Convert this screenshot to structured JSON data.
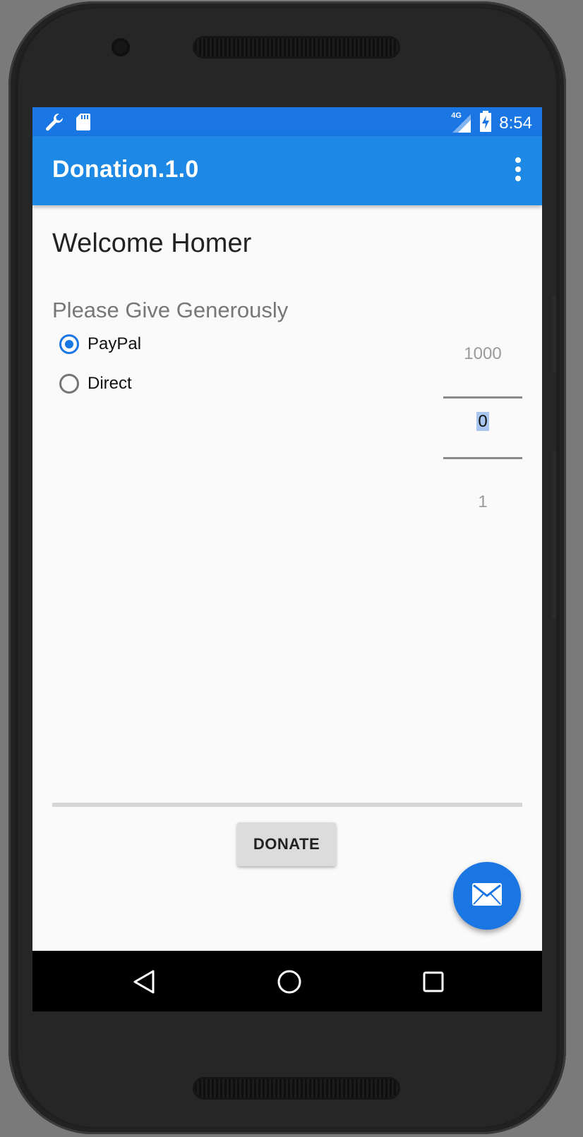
{
  "status_bar": {
    "time": "8:54",
    "network": "4G",
    "icons": [
      "wrench-icon",
      "sd-card-icon",
      "signal-icon",
      "battery-charging-icon"
    ]
  },
  "app_bar": {
    "title": "Donation.1.0",
    "menu_icon": "overflow-menu-icon"
  },
  "main": {
    "welcome": "Welcome Homer",
    "prompt": "Please Give Generously",
    "payment_options": [
      {
        "label": "PayPal",
        "checked": true
      },
      {
        "label": "Direct",
        "checked": false
      }
    ],
    "amount_picker": {
      "previous": "1000",
      "current": "0",
      "next": "1"
    },
    "progress": 0,
    "donate_label": "DONATE",
    "fab_icon": "mail-icon"
  },
  "nav_bar": {
    "icons": [
      "back-icon",
      "home-icon",
      "recents-icon"
    ]
  },
  "colors": {
    "status_bar": "#1976e3",
    "app_bar": "#1e88e5",
    "accent": "#1976e3",
    "background": "#fafafa"
  }
}
